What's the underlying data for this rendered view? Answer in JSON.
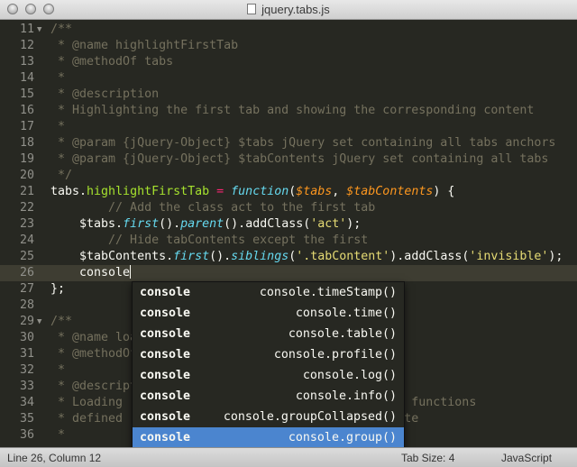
{
  "window": {
    "title": "jquery.tabs.js"
  },
  "editor": {
    "lines": [
      {
        "num": "11",
        "fold": "▼",
        "tokens": [
          {
            "c": "c",
            "t": "/**"
          }
        ]
      },
      {
        "num": "12",
        "tokens": [
          {
            "c": "c",
            "t": " * @name highlightFirstTab"
          }
        ]
      },
      {
        "num": "13",
        "tokens": [
          {
            "c": "c",
            "t": " * @methodOf tabs"
          }
        ]
      },
      {
        "num": "14",
        "tokens": [
          {
            "c": "c",
            "t": " *"
          }
        ]
      },
      {
        "num": "15",
        "tokens": [
          {
            "c": "c",
            "t": " * @description"
          }
        ]
      },
      {
        "num": "16",
        "tokens": [
          {
            "c": "c",
            "t": " * Highlighting the first tab and showing the corresponding content"
          }
        ]
      },
      {
        "num": "17",
        "tokens": [
          {
            "c": "c",
            "t": " *"
          }
        ]
      },
      {
        "num": "18",
        "tokens": [
          {
            "c": "c",
            "t": " * @param {jQuery-Object} $tabs jQuery set containing all tabs anchors"
          }
        ]
      },
      {
        "num": "19",
        "tokens": [
          {
            "c": "c",
            "t": " * @param {jQuery-Object} $tabContents jQuery set containing all tabs"
          }
        ]
      },
      {
        "num": "20",
        "tokens": [
          {
            "c": "c",
            "t": " */"
          }
        ]
      },
      {
        "num": "21",
        "tokens": [
          {
            "c": "",
            "t": "tabs."
          },
          {
            "c": "g",
            "t": "highlightFirstTab"
          },
          {
            "c": "",
            "t": " "
          },
          {
            "c": "o",
            "t": "="
          },
          {
            "c": "",
            "t": " "
          },
          {
            "c": "cyan",
            "t": "function"
          },
          {
            "c": "",
            "t": "("
          },
          {
            "c": "p",
            "t": "$tabs"
          },
          {
            "c": "",
            "t": ", "
          },
          {
            "c": "p",
            "t": "$tabContents"
          },
          {
            "c": "",
            "t": ") {"
          }
        ]
      },
      {
        "num": "22",
        "tokens": [
          {
            "c": "c",
            "t": "        // Add the class act to the first tab"
          }
        ]
      },
      {
        "num": "23",
        "tokens": [
          {
            "c": "",
            "t": "    $tabs."
          },
          {
            "c": "cyan",
            "t": "first"
          },
          {
            "c": "",
            "t": "()."
          },
          {
            "c": "cyan",
            "t": "parent"
          },
          {
            "c": "",
            "t": "()."
          },
          {
            "c": "",
            "t": "addClass("
          },
          {
            "c": "s",
            "t": "'act'"
          },
          {
            "c": "",
            "t": ");"
          }
        ]
      },
      {
        "num": "24",
        "tokens": [
          {
            "c": "c",
            "t": "        // Hide tabContents except the first"
          }
        ]
      },
      {
        "num": "25",
        "tokens": [
          {
            "c": "",
            "t": "    $tabContents."
          },
          {
            "c": "cyan",
            "t": "first"
          },
          {
            "c": "",
            "t": "()."
          },
          {
            "c": "cyan",
            "t": "siblings"
          },
          {
            "c": "",
            "t": "("
          },
          {
            "c": "s",
            "t": "'.tabContent'"
          },
          {
            "c": "",
            "t": ").addClass("
          },
          {
            "c": "s",
            "t": "'invisible'"
          },
          {
            "c": "",
            "t": ");"
          }
        ]
      },
      {
        "num": "26",
        "current": true,
        "cursor": true,
        "tokens": [
          {
            "c": "",
            "t": "    console"
          }
        ]
      },
      {
        "num": "27",
        "tokens": [
          {
            "c": "",
            "t": "};"
          }
        ]
      },
      {
        "num": "28",
        "tokens": [
          {
            "c": "",
            "t": ""
          }
        ]
      },
      {
        "num": "29",
        "fold": "▼",
        "tokens": [
          {
            "c": "c",
            "t": "/**"
          }
        ]
      },
      {
        "num": "30",
        "tokens": [
          {
            "c": "c",
            "t": " * @name loa"
          }
        ]
      },
      {
        "num": "31",
        "tokens": [
          {
            "c": "c",
            "t": " * @methodOf"
          }
        ]
      },
      {
        "num": "32",
        "tokens": [
          {
            "c": "c",
            "t": " *"
          }
        ]
      },
      {
        "num": "33",
        "tokens": [
          {
            "c": "c",
            "t": " * @descript"
          }
        ]
      },
      {
        "num": "34",
        "tokens": [
          {
            "c": "c",
            "t": " * Loading                                  l the functions"
          }
        ]
      },
      {
        "num": "35",
        "tokens": [
          {
            "c": "c",
            "t": " * defined                                   mplete"
          }
        ]
      },
      {
        "num": "36",
        "tokens": [
          {
            "c": "c",
            "t": " *"
          }
        ]
      }
    ]
  },
  "autocomplete": {
    "items": [
      {
        "trigger": "console",
        "annotation": "console.timeStamp()",
        "selected": false
      },
      {
        "trigger": "console",
        "annotation": "console.time()",
        "selected": false
      },
      {
        "trigger": "console",
        "annotation": "console.table()",
        "selected": false
      },
      {
        "trigger": "console",
        "annotation": "console.profile()",
        "selected": false
      },
      {
        "trigger": "console",
        "annotation": "console.log()",
        "selected": false
      },
      {
        "trigger": "console",
        "annotation": "console.info()",
        "selected": false
      },
      {
        "trigger": "console",
        "annotation": "console.groupCollapsed()",
        "selected": false
      },
      {
        "trigger": "console",
        "annotation": "console.group()",
        "selected": true
      }
    ]
  },
  "statusbar": {
    "position": "Line 26, Column 12",
    "tab_size": "Tab Size: 4",
    "syntax": "JavaScript"
  }
}
